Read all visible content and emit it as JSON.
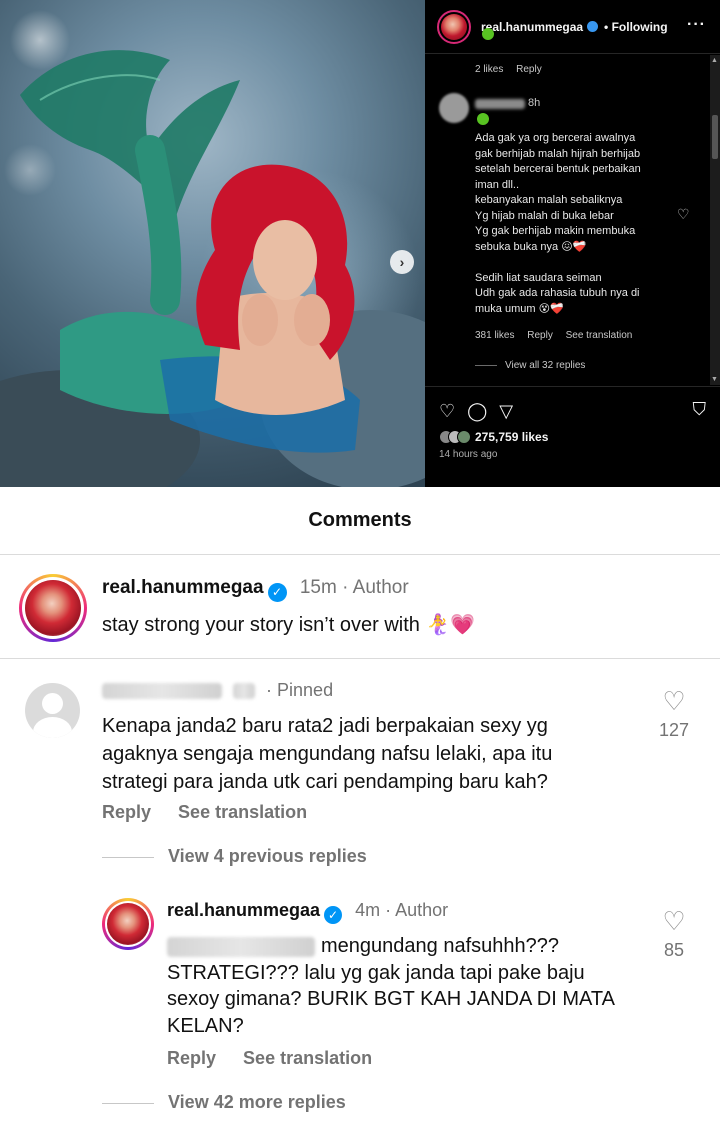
{
  "post_view": {
    "username": "real.hanummegaa",
    "follow_state": "Following",
    "more_label": "···",
    "next_label": "›",
    "prev_reply_meta": {
      "likes": "2 likes",
      "reply": "Reply"
    },
    "comment": {
      "user": "",
      "time": "8h",
      "text_lines": [
        "Ada gak ya org bercerai awalnya",
        "gak berhijab malah hijrah berhijab",
        "setelah bercerai bentuk perbaikan",
        "iman dll..",
        "kebanyakan malah sebaliknya",
        "Yg hijab malah di buka lebar",
        "Yg gak berhijab makin membuka",
        "sebuka buka nya 😖❤️‍🩹",
        "",
        "Sedih liat saudara seiman",
        "Udh gak ada rahasia tubuh nya di",
        "muka umum 😵❤️‍🩹"
      ],
      "likes": "381 likes",
      "reply": "Reply",
      "see_translation": "See translation",
      "view_replies": "View all 32 replies"
    },
    "icons": {
      "like": "heart-icon",
      "comment": "comment-icon",
      "share": "send-icon",
      "save": "bookmark-icon"
    },
    "likes_count": "275,759 likes",
    "posted": "14 hours ago"
  },
  "comments_sheet": {
    "title": "Comments",
    "caption": {
      "username": "real.hanummegaa",
      "time": "15m",
      "role": "Author",
      "text": "stay strong your story isn’t over with 🧜‍♀️💗"
    },
    "pinned_comment": {
      "username": "",
      "time": "",
      "pinned_label": "Pinned",
      "text": "Kenapa janda2 baru rata2 jadi berpakaian sexy yg agaknya sengaja mengundang nafsu lelaki, apa itu strategi para janda utk cari pendamping baru kah?",
      "reply": "Reply",
      "see_translation": "See translation",
      "likes": "127",
      "view_previous": "View 4 previous replies"
    },
    "author_reply": {
      "username": "real.hanummegaa",
      "time": "4m",
      "role": "Author",
      "mention": "",
      "text": "mengundang nafsuhhh??? STRATEGI??? lalu yg gak janda tapi pake baju sexoy gimana? BURIK BGT KAH JANDA DI MATA KELAN?",
      "reply": "Reply",
      "see_translation": "See translation",
      "likes": "85",
      "view_more": "View 42 more replies"
    }
  },
  "colors": {
    "verified": "#0095f6",
    "meta": "#737373",
    "divider": "#dbdbdb"
  }
}
